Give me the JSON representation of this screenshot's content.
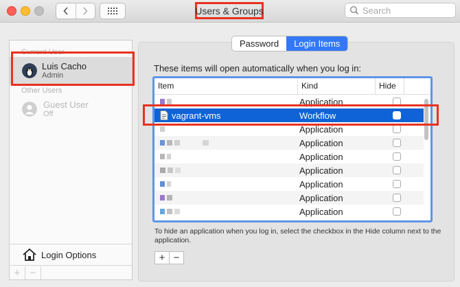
{
  "window": {
    "title": "Users & Groups"
  },
  "toolbar": {
    "search_placeholder": "Search",
    "icons": [
      "chevron-left-icon",
      "chevron-right-icon",
      "grid-icon",
      "search-icon"
    ]
  },
  "sidebar": {
    "current_users_label": "Current User",
    "other_users_label": "Other Users",
    "users": [
      {
        "name": "Luis Cacho",
        "role": "Admin"
      },
      {
        "name": "Guest User",
        "role": "Off"
      }
    ],
    "login_options_label": "Login Options",
    "add_label": "+",
    "remove_label": "−"
  },
  "tabs": {
    "password": "Password",
    "login_items": "Login Items",
    "active": "Login Items"
  },
  "main": {
    "description": "These items will open automatically when you log in:",
    "columns": {
      "item": "Item",
      "kind": "Kind",
      "hide": "Hide"
    },
    "rows": [
      {
        "item": "",
        "kind": "Application",
        "hidden": false
      },
      {
        "item": "vagrant-vms",
        "kind": "Workflow",
        "hidden": false
      },
      {
        "item": "",
        "kind": "Application",
        "hidden": false
      },
      {
        "item": "",
        "kind": "Application",
        "hidden": false
      },
      {
        "item": "",
        "kind": "Application",
        "hidden": false
      },
      {
        "item": "",
        "kind": "Application",
        "hidden": false
      },
      {
        "item": "",
        "kind": "Application",
        "hidden": false
      },
      {
        "item": "",
        "kind": "Application",
        "hidden": false
      },
      {
        "item": "",
        "kind": "Application",
        "hidden": false
      }
    ],
    "help_text": "To hide an application when you log in, select the checkbox in the Hide column next to the application.",
    "add_label": "+",
    "remove_label": "−"
  },
  "colors": {
    "accent": "#3478f6",
    "selection": "#0f63d6",
    "highlight_box": "#e8311f"
  }
}
